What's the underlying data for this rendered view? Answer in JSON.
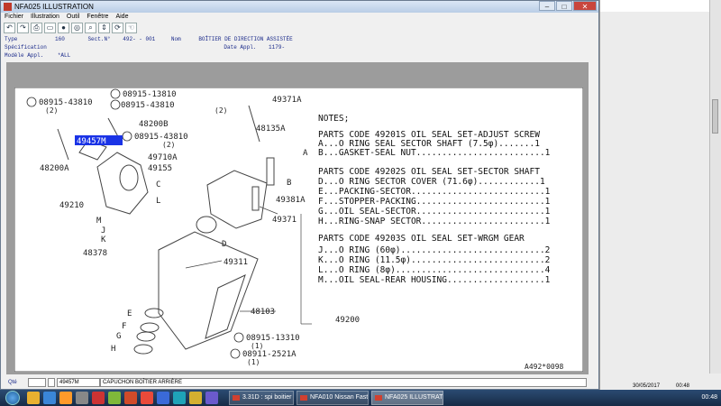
{
  "window": {
    "title": "NFA025 ILLUSTRATION",
    "menu": [
      "Fichier",
      "Illustration",
      "Outil",
      "Fenêtre",
      "Aide"
    ]
  },
  "info": {
    "type_label": "Type",
    "type_value": "160",
    "sect_label": "Sect.N°",
    "sect_value": "492- - 001",
    "nom_label": "Nom",
    "nom_value": "BOÎTIER DE DIRECTION ASSISTÉE",
    "spec_label": "Spécification",
    "date_label": "Date Appl.",
    "date_value": "1179-",
    "modele_label": "Modèle Appl.",
    "modele_value": "*ALL"
  },
  "drawing": {
    "callouts": {
      "c1": "08915-13810",
      "c1b": "(2)",
      "c2": "08915-43810",
      "c2b": "(2)",
      "c3": "08915-43810",
      "c3b": "(2)",
      "c4": "08915-43810",
      "c4b": "(2)",
      "c5": "08915-13310",
      "c5b": "(1)",
      "c6": "08911-2521A",
      "c6b": "(1)"
    },
    "parts": {
      "p1": "49371A",
      "p2": "48200B",
      "p3": "48135A",
      "p4": "49457M",
      "p5": "49710A",
      "p6": "49155",
      "p7": "48200A",
      "p8": "49210",
      "p9": "49381A",
      "p10": "49371",
      "p11": "48378",
      "p12": "49311",
      "p13": "48103",
      "p14": "49200",
      "p15": "A492*0098"
    },
    "letters": {
      "A": "A",
      "B": "B",
      "C": "C",
      "D": "D",
      "E": "E",
      "F": "F",
      "G": "G",
      "H": "H",
      "J": "J",
      "K": "K",
      "L": "L",
      "M": "M"
    },
    "notes_title": "NOTES;",
    "notes": [
      "PARTS CODE 49201S OIL SEAL SET-ADJUST SCREW",
      "A...O RING SEAL SECTOR SHAFT (7.5φ).......1",
      "B...GASKET-SEAL NUT.........................1",
      "PARTS CODE 49202S OIL SEAL SET-SECTOR SHAFT",
      "D...O RING SECTOR COVER (71.6φ)............1",
      "E...PACKING-SECTOR..........................1",
      "F...STOPPER-PACKING.........................1",
      "G...OIL SEAL-SECTOR.........................1",
      "H...RING-SNAP SECTOR........................1",
      "PARTS CODE 49203S OIL SEAL SET-WRGM GEAR",
      "J...O RING (60φ)............................2",
      "K...O RING (11.5φ)..........................2",
      "L...O RING (8φ).............................4",
      "M...OIL SEAL-REAR HOUSING...................1"
    ]
  },
  "footer": {
    "qte_label": "Qté",
    "part_code": "49457M",
    "part_desc": "CAPUCHON BOÎTIER ARRIÈRE"
  },
  "right_panel": {
    "date": "30/05/2017",
    "time": "00:48"
  },
  "taskbar": {
    "tasks": [
      "3.31D : spi boitier de...",
      "NFA010 Nissan Fast ...",
      "NFA025 ILLUSTRAT..."
    ],
    "clock": "00:48"
  },
  "colors": {
    "highlight": "#1a33e6",
    "drawing_bg": "#ffffff",
    "panel_bg": "#9c9c9c"
  }
}
